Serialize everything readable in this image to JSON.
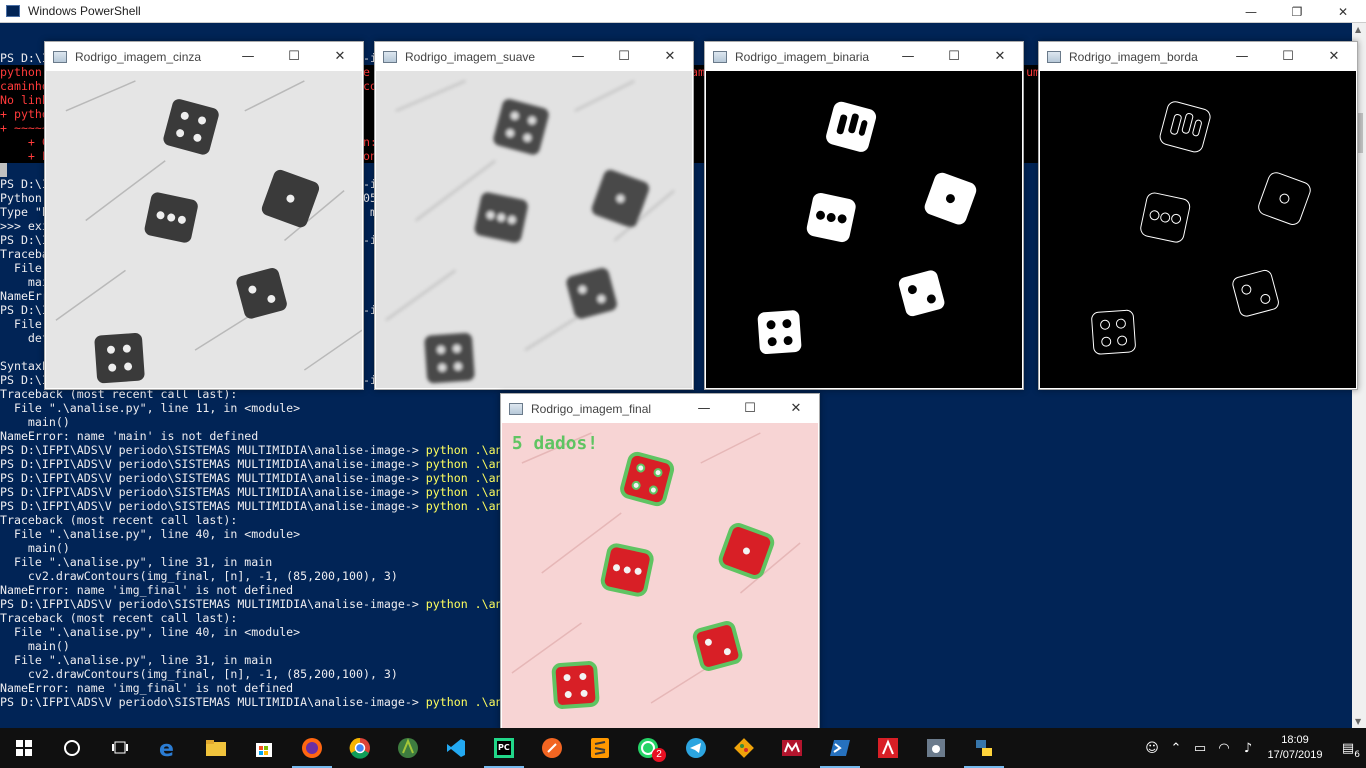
{
  "powershell": {
    "title": "Windows PowerShell",
    "controls": {
      "minimize": "—",
      "restore": "❐",
      "close": "✕"
    }
  },
  "console_lines": [
    {
      "t": "PS D:\\IFPI\\ADS\\V periodo\\SISTEMAS MULTIMIDIA\\analise-image-> python .\\analise.py",
      "c": ""
    },
    {
      "t": "python : O termo 'python' não é reconhecido como nome de cmdlet, função, arquivo de script ou programa operável. Verifique a grafia do nome ou, se um ",
      "c": "err"
    },
    {
      "t": "caminho tiver sido incluído, veja se o caminho está correto e tente novamente.",
      "c": "err"
    },
    {
      "t": "No linha:1 caractere:1",
      "c": "err"
    },
    {
      "t": "+ python .\\analise.py",
      "c": "err"
    },
    {
      "t": "+ ~~~~~~",
      "c": "err"
    },
    {
      "t": "    + CategoryInfo          : ObjectNotFound: (python:String) [], CommandNotFoundException",
      "c": "err"
    },
    {
      "t": "    + FullyQualifiedErrorId : CommandNotFoundException",
      "c": "err"
    },
    {
      "t": " ",
      "c": "cursor"
    },
    {
      "t": "PS D:\\IFPI\\ADS\\V periodo\\SISTEMAS MULTIMIDIA\\analise-image-> python",
      "c": ""
    },
    {
      "t": "Python 3.7.3 (v3.7.3:ef4ec6ed12, Mar 25 2019, 22:22:05) [MSC v.1916 64 bit (AMD64)] on win32",
      "c": ""
    },
    {
      "t": "Type \"help\", \"copyright\", \"credits\" or \"license\" for more information.",
      "c": ""
    },
    {
      "t": ">>> exit()",
      "c": ""
    },
    {
      "t": "PS D:\\IFPI\\ADS\\V periodo\\SISTEMAS MULTIMIDIA\\analise-image-> python .\\analise.py",
      "c": ""
    },
    {
      "t": "Traceback (most recent call last):",
      "c": ""
    },
    {
      "t": "  File \".\\analise.py\", line 11, in <module>",
      "c": ""
    },
    {
      "t": "    main()",
      "c": ""
    },
    {
      "t": "NameError: name 'main' is not defined",
      "c": ""
    },
    {
      "t": "PS D:\\IFPI\\ADS\\V periodo\\SISTEMAS MULTIMIDIA\\analise-image-> python .\\analise.py",
      "c": ""
    },
    {
      "t": "  File \".\\analise.py\", line 4",
      "c": ""
    },
    {
      "t": "    def main():",
      "c": ""
    },
    {
      "t": "",
      "c": ""
    },
    {
      "t": "SyntaxError: invalid syntax",
      "c": ""
    },
    {
      "t": "PS D:\\IFPI\\ADS\\V periodo\\SISTEMAS MULTIMIDIA\\analise-image-> python .\\analise.py",
      "c": ""
    },
    {
      "t": "Traceback (most recent call last):",
      "c": ""
    },
    {
      "t": "  File \".\\analise.py\", line 11, in <module>",
      "c": ""
    },
    {
      "t": "    main()",
      "c": ""
    },
    {
      "t": "NameError: name 'main' is not defined",
      "c": ""
    },
    {
      "t": "PS D:\\IFPI\\ADS\\V periodo\\SISTEMAS MULTIMIDIA\\analise-image-> ",
      "cmd": "python .\\analise.py",
      "c": ""
    },
    {
      "t": "PS D:\\IFPI\\ADS\\V periodo\\SISTEMAS MULTIMIDIA\\analise-image-> ",
      "cmd": "python .\\analise.py",
      "c": ""
    },
    {
      "t": "PS D:\\IFPI\\ADS\\V periodo\\SISTEMAS MULTIMIDIA\\analise-image-> ",
      "cmd": "python .\\analise.py",
      "c": ""
    },
    {
      "t": "PS D:\\IFPI\\ADS\\V periodo\\SISTEMAS MULTIMIDIA\\analise-image-> ",
      "cmd": "python .\\analise.py",
      "c": ""
    },
    {
      "t": "PS D:\\IFPI\\ADS\\V periodo\\SISTEMAS MULTIMIDIA\\analise-image-> ",
      "cmd": "python .\\analise.py",
      "c": ""
    },
    {
      "t": "Traceback (most recent call last):",
      "c": ""
    },
    {
      "t": "  File \".\\analise.py\", line 40, in <module>",
      "c": ""
    },
    {
      "t": "    main()",
      "c": ""
    },
    {
      "t": "  File \".\\analise.py\", line 31, in main",
      "c": ""
    },
    {
      "t": "    cv2.drawContours(img_final, [n], -1, (85,200,100), 3)",
      "c": ""
    },
    {
      "t": "NameError: name 'img_final' is not defined",
      "c": ""
    },
    {
      "t": "PS D:\\IFPI\\ADS\\V periodo\\SISTEMAS MULTIMIDIA\\analise-image-> ",
      "cmd": "python .\\analise.py",
      "c": ""
    },
    {
      "t": "Traceback (most recent call last):",
      "c": ""
    },
    {
      "t": "  File \".\\analise.py\", line 40, in <module>",
      "c": ""
    },
    {
      "t": "    main()",
      "c": ""
    },
    {
      "t": "  File \".\\analise.py\", line 31, in main",
      "c": ""
    },
    {
      "t": "    cv2.drawContours(img_final, [n], -1, (85,200,100), 3)",
      "c": ""
    },
    {
      "t": "NameError: name 'img_final' is not defined",
      "c": ""
    },
    {
      "t": "PS D:\\IFPI\\ADS\\V periodo\\SISTEMAS MULTIMIDIA\\analise-image-> ",
      "cmd": "python .\\analise.py",
      "c": ""
    }
  ],
  "windows": {
    "cinza": {
      "title": "Rodrigo_imagem_cinza"
    },
    "suave": {
      "title": "Rodrigo_imagem_suave"
    },
    "binaria": {
      "title": "Rodrigo_imagem_binaria"
    },
    "borda": {
      "title": "Rodrigo_imagem_borda"
    },
    "final": {
      "title": "Rodrigo_imagem_final",
      "overlay_text": "5 dados!"
    }
  },
  "win_controls": {
    "minimize": "—",
    "maximize": "☐",
    "close": "✕"
  },
  "colors": {
    "console_bg": "#012456",
    "command_yellow": "#ffff5e",
    "error_red": "#ff3b3b",
    "contour_green": "#5fc462",
    "dice_red": "#d81f26"
  },
  "taskbar": {
    "apps": [
      "start-icon",
      "cortana-icon",
      "task-view-icon",
      "edge-icon",
      "file-explorer-icon",
      "store-icon",
      "firefox-icon",
      "chrome-icon",
      "android-studio-icon",
      "vscode-icon",
      "pycharm-icon",
      "app-orange-icon",
      "sublime-icon",
      "whatsapp-icon",
      "telegram-icon",
      "git-icon",
      "mendeley-icon",
      "powershell-icon",
      "acrobat-icon",
      "app-gray-icon",
      "python-icon"
    ],
    "whatsapp_badge": "2",
    "notification_count": "6",
    "time": "18:09",
    "date": "17/07/2019"
  }
}
